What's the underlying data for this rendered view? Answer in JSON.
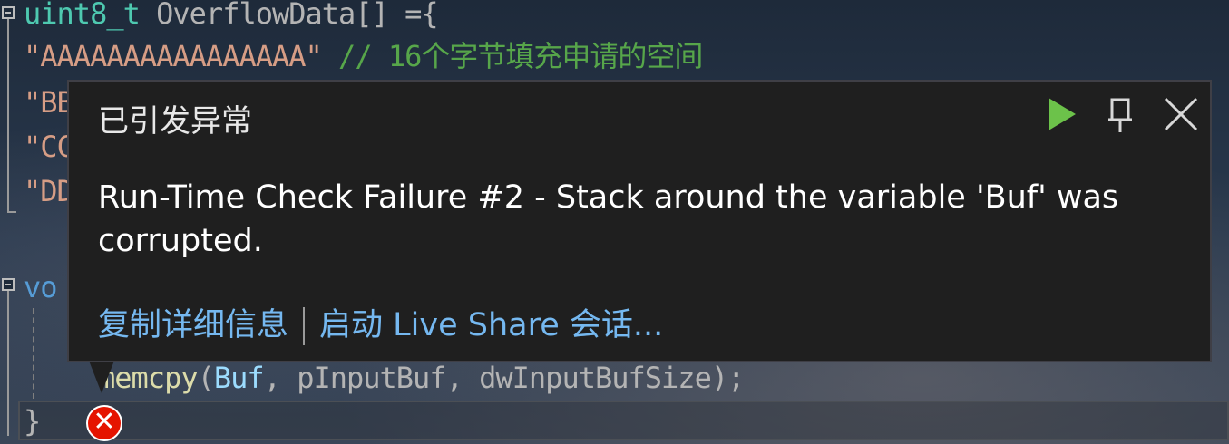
{
  "editor": {
    "lines": [
      {
        "parts": [
          {
            "t": "uint8_t",
            "c": "tok-type"
          },
          {
            "t": " OverflowData[] ={",
            "c": "tok-op"
          }
        ]
      },
      {
        "parts": [
          {
            "t": "\"AAAAAAAAAAAAAAAA\"",
            "c": "tok-str"
          },
          {
            "t": " // 16个字节填充申请的空间",
            "c": "tok-cmt"
          }
        ]
      },
      {
        "parts": [
          {
            "t": "\"BB",
            "c": "tok-str"
          }
        ]
      },
      {
        "parts": [
          {
            "t": "\"CC",
            "c": "tok-str"
          }
        ]
      },
      {
        "parts": [
          {
            "t": "\"DD",
            "c": "tok-str"
          }
        ]
      },
      {
        "parts": [
          {
            "t": "vo",
            "c": "tok-kw"
          }
        ]
      },
      {
        "parts": [
          {
            "t": "memcpy",
            "c": "tok-fn"
          },
          {
            "t": "(",
            "c": "tok-op"
          },
          {
            "t": "Buf",
            "c": "tok-id"
          },
          {
            "t": ", pInputBuf, dwInputBufSize);",
            "c": "tok-op"
          }
        ]
      },
      {
        "parts": [
          {
            "t": "}",
            "c": "tok-op"
          }
        ]
      }
    ]
  },
  "popup": {
    "title": "已引发异常",
    "message": "Run-Time Check Failure #2 - Stack around the variable 'Buf' was corrupted.",
    "link_copy": "复制详细信息",
    "link_liveshare": "启动 Live Share 会话...",
    "icons": {
      "continue": "play-icon",
      "pin": "pin-icon",
      "close": "close-icon"
    },
    "accent": "#75b8f0",
    "continue_color": "#6cc24a"
  },
  "error_glyph": {
    "icon": "error-icon",
    "color": "#e51400"
  }
}
